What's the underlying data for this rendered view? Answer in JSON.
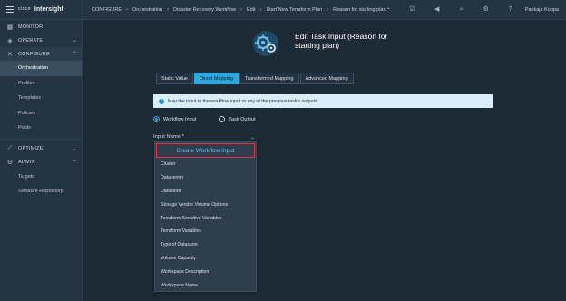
{
  "brand": {
    "cisco": "cisco",
    "name": "Intersight"
  },
  "sidebar": {
    "sections": [
      {
        "label": "MONITOR",
        "icon": "monitor-icon"
      },
      {
        "label": "OPERATE",
        "icon": "operate-icon"
      },
      {
        "label": "CONFIGURE",
        "icon": "configure-icon"
      }
    ],
    "configure_items": [
      "Orchestration",
      "Profiles",
      "Templates",
      "Policies",
      "Pools"
    ],
    "optimize": "OPTIMIZE",
    "admin": "ADMIN",
    "admin_items": [
      "Targets",
      "Software Repository"
    ]
  },
  "breadcrumb": [
    "CONFIGURE",
    "Orchestration",
    "Disaster Recovery Workflow",
    "Edit",
    "Start New Terraform Plan",
    "Reason for starting plan"
  ],
  "user": "Pankaja Koppa",
  "page": {
    "title": "Edit Task Input (Reason for starting plan)"
  },
  "tabs": [
    "Static Value",
    "Direct Mapping",
    "Transformed Mapping",
    "Advanced Mapping"
  ],
  "info": "Map the input to the workflow input or any of the previous task's outputs.",
  "radios": {
    "workflow_input": "Workflow Input",
    "task_output": "Task Output"
  },
  "field": {
    "label": "Input Name *"
  },
  "dropdown": {
    "create_label": "Create Workflow Input",
    "options": [
      "Cluster",
      "Datacenter",
      "Datastore",
      "Storage Vendor Volume Options",
      "Terraform Sensitive Variables",
      "Terraform Variables",
      "Type of Datastore",
      "Volume Capacity",
      "Workspace Description",
      "Workspace Name"
    ]
  }
}
